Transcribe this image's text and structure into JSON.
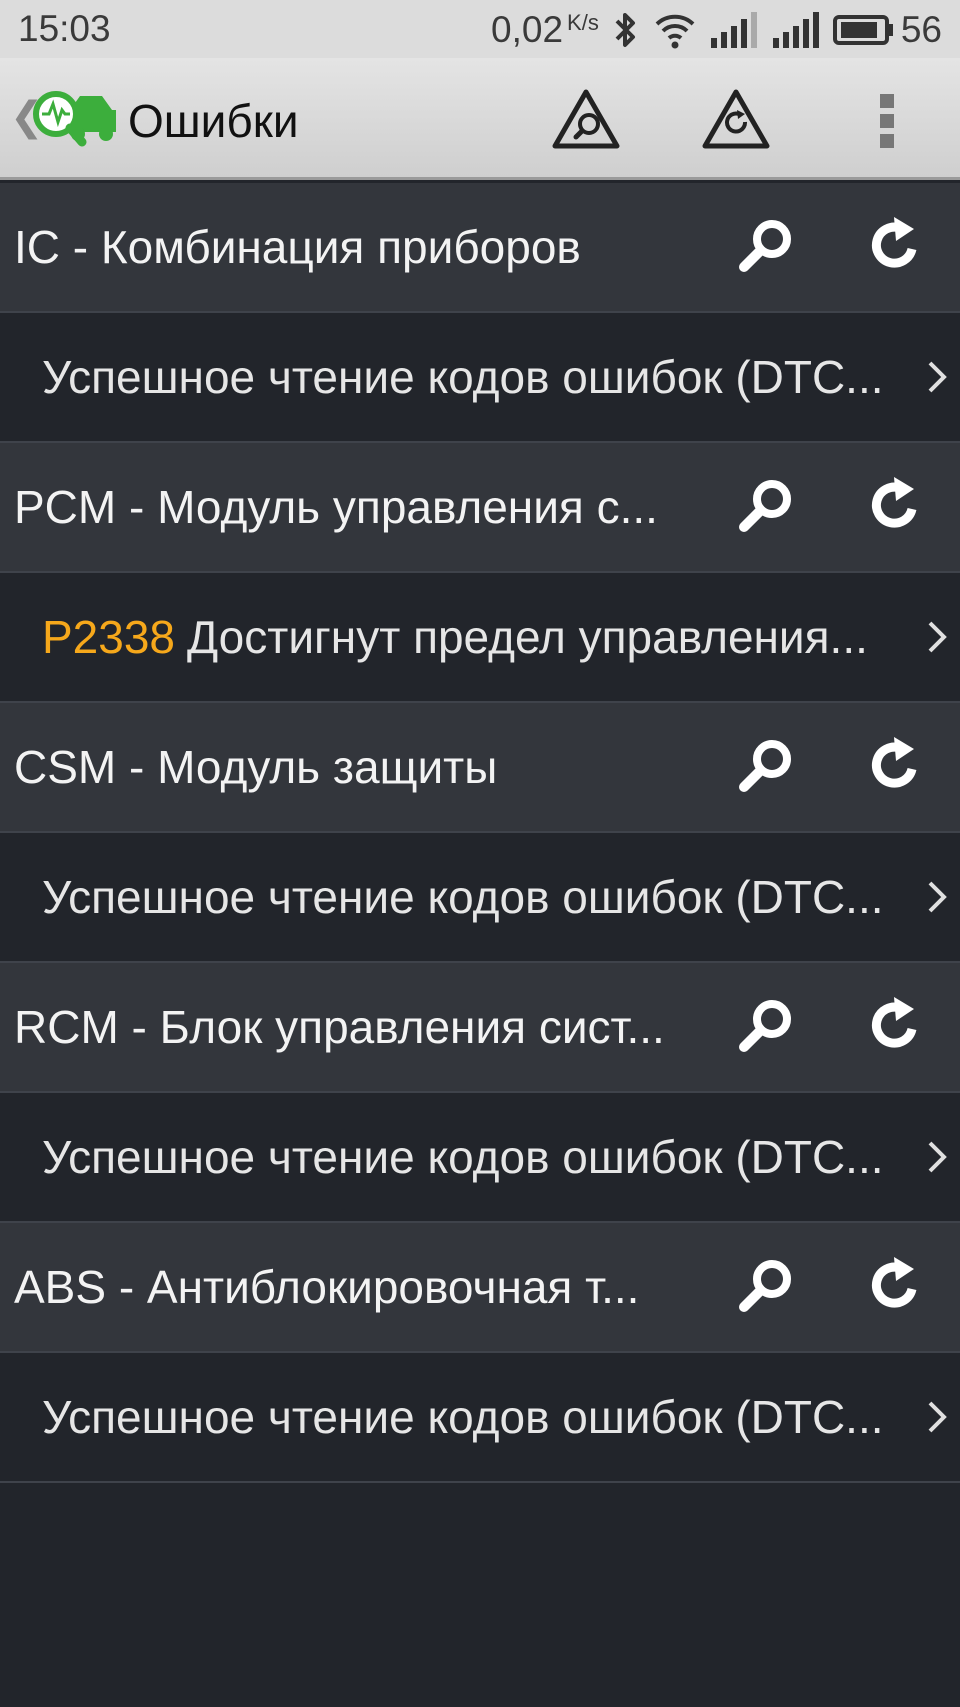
{
  "status_bar": {
    "time": "15:03",
    "network_speed": "0,02",
    "network_unit": "K/s",
    "battery_level": "56",
    "icons": [
      "bluetooth-icon",
      "wifi-icon",
      "signal-icon",
      "signal-icon",
      "battery-icon"
    ]
  },
  "app_bar": {
    "title": "Ошибки",
    "actions": [
      "scan-all-icon",
      "refresh-all-icon",
      "overflow-menu-icon"
    ]
  },
  "modules": [
    {
      "title": "IC - Комбинация приборов",
      "detail_code": "",
      "detail_text": "Успешное чтение кодов ошибок (DTC..."
    },
    {
      "title": "PCM - Модуль управления с...",
      "detail_code": "P2338",
      "detail_text": "Достигнут предел управления..."
    },
    {
      "title": "CSM - Модуль защиты",
      "detail_code": "",
      "detail_text": "Успешное чтение кодов ошибок (DTC..."
    },
    {
      "title": "RCM - Блок управления сист...",
      "detail_code": "",
      "detail_text": "Успешное чтение кодов ошибок (DTC..."
    },
    {
      "title": "ABS - Антиблокировочная т...",
      "detail_code": "",
      "detail_text": "Успешное чтение кодов ошибок (DTC..."
    }
  ],
  "colors": {
    "accent_code": "#f6a81b",
    "logo_green": "#3cae3c",
    "background": "#22252b",
    "module_row": "#33363c"
  }
}
